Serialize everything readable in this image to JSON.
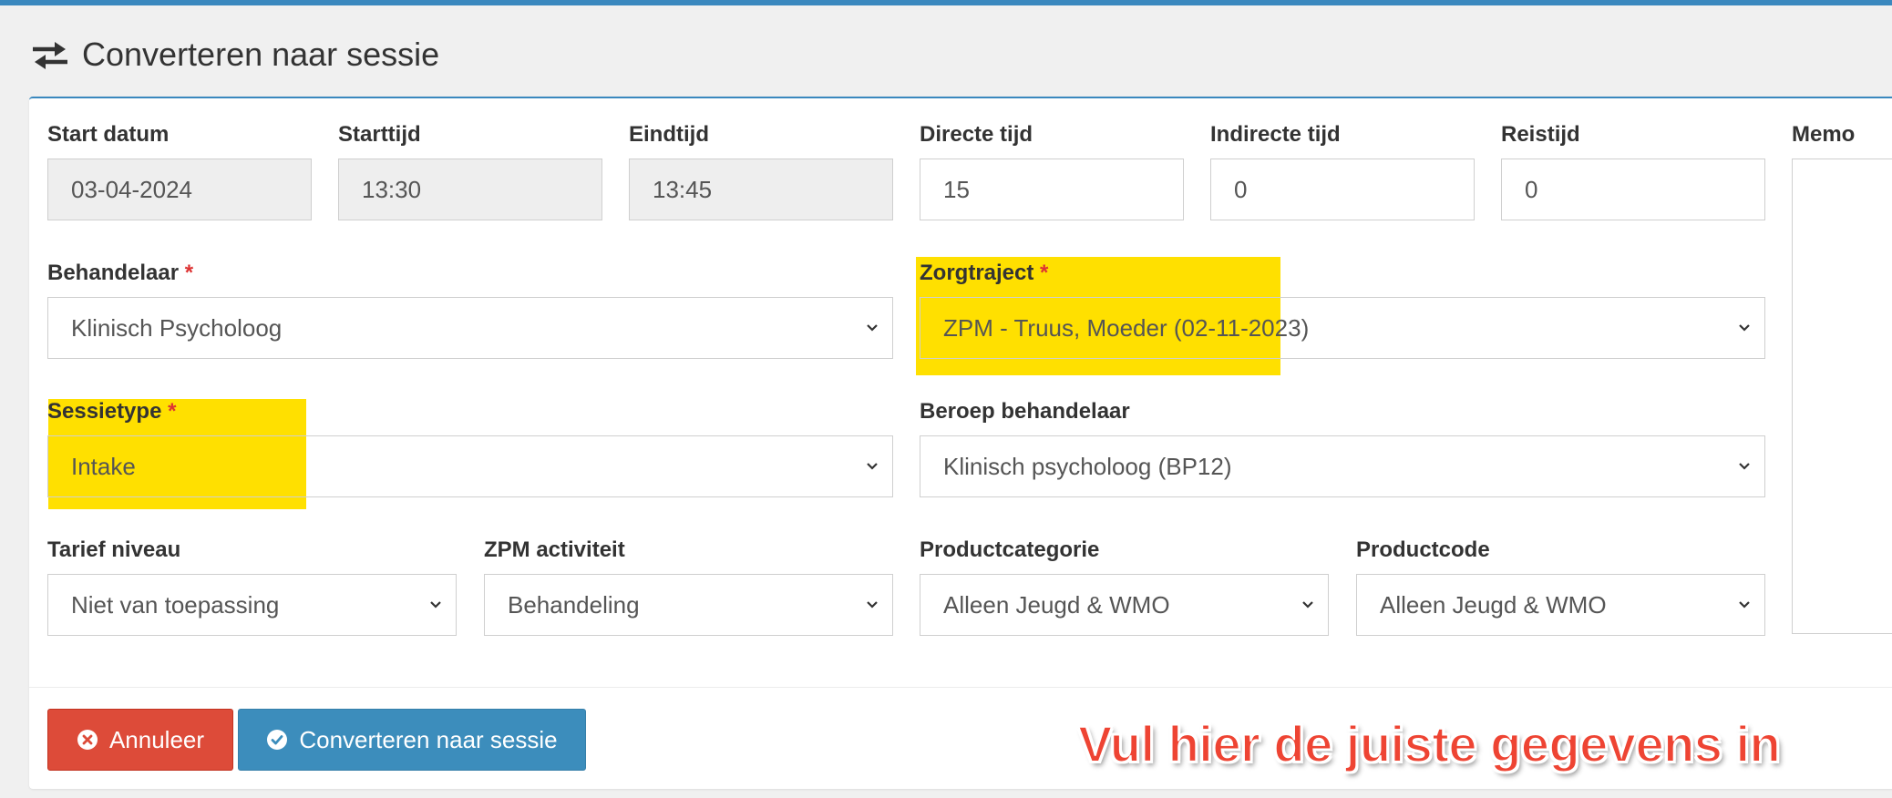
{
  "header": {
    "title": "Converteren naar sessie",
    "icon": "exchange-arrows-icon"
  },
  "colors": {
    "accent": "#3a88be",
    "highlight": "#ffe000",
    "danger": "#dd4b39",
    "primary": "#3c8dbc",
    "required": "#dd3333",
    "annotation": "#ee4433"
  },
  "form": {
    "start_datum": {
      "label": "Start datum",
      "value": "03-04-2024"
    },
    "starttijd": {
      "label": "Starttijd",
      "value": "13:30"
    },
    "eindtijd": {
      "label": "Eindtijd",
      "value": "13:45"
    },
    "directe_tijd": {
      "label": "Directe tijd",
      "value": "15"
    },
    "indirecte_tijd": {
      "label": "Indirecte tijd",
      "value": "0"
    },
    "reistijd": {
      "label": "Reistijd",
      "value": "0"
    },
    "memo": {
      "label": "Memo",
      "value": ""
    },
    "behandelaar": {
      "label": "Behandelaar",
      "required": "*",
      "value": "Klinisch Psycholoog"
    },
    "zorgtraject": {
      "label": "Zorgtraject",
      "required": "*",
      "value": "ZPM - Truus, Moeder (02-11-2023)"
    },
    "sessietype": {
      "label": "Sessietype",
      "required": "*",
      "value": "Intake"
    },
    "beroep_behandelaar": {
      "label": "Beroep behandelaar",
      "value": "Klinisch psycholoog (BP12)"
    },
    "tarief_niveau": {
      "label": "Tarief niveau",
      "value": "Niet van toepassing"
    },
    "zpm_activiteit": {
      "label": "ZPM activiteit",
      "value": "Behandeling"
    },
    "productcategorie": {
      "label": "Productcategorie",
      "value": "Alleen Jeugd & WMO"
    },
    "productcode": {
      "label": "Productcode",
      "value": "Alleen Jeugd & WMO"
    }
  },
  "buttons": {
    "cancel": {
      "label": "Annuleer",
      "icon": "times-circle-icon"
    },
    "convert": {
      "label": "Converteren naar sessie",
      "icon": "check-circle-icon"
    }
  },
  "annotation": {
    "text": "Vul hier de juiste gegevens in"
  }
}
